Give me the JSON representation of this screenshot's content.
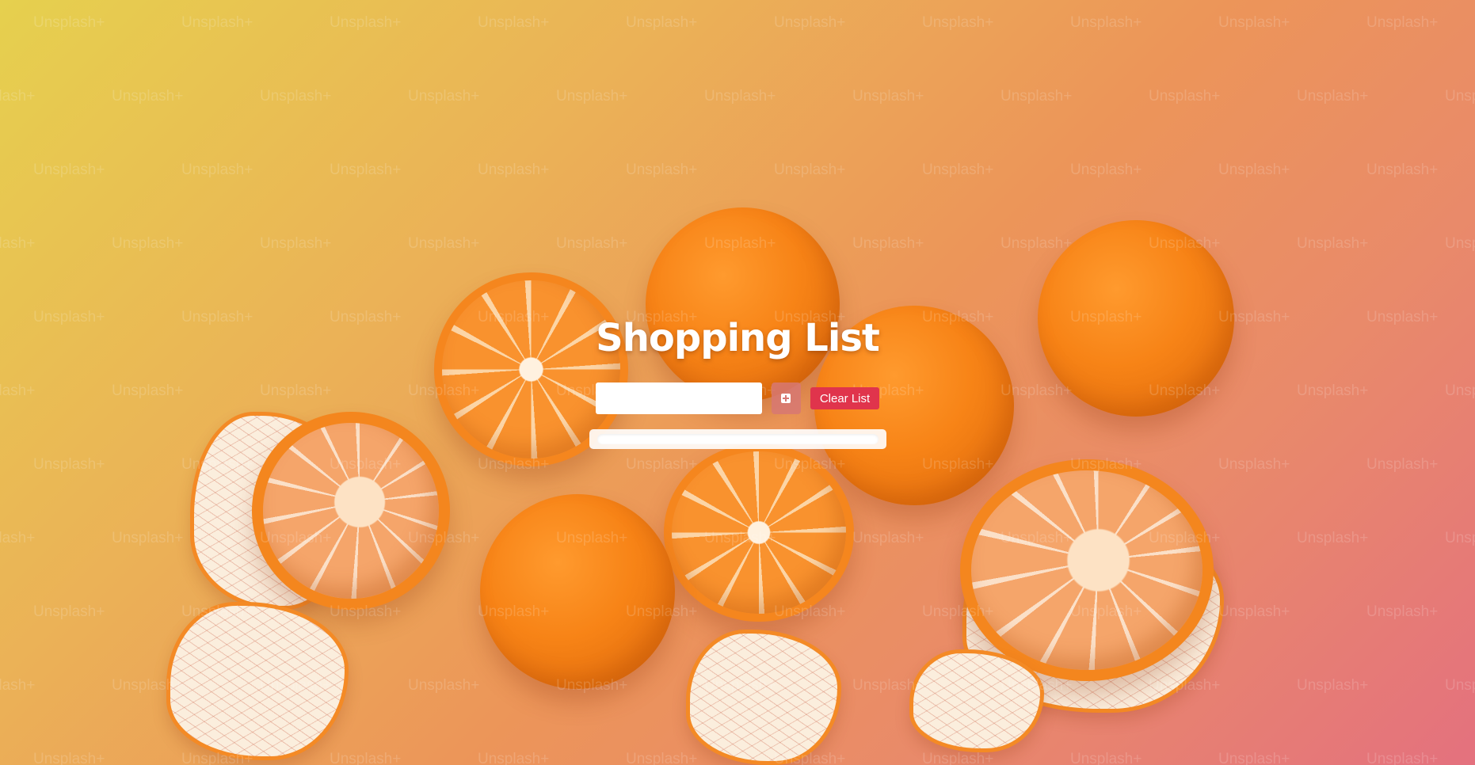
{
  "app": {
    "title": "Shopping List",
    "input": {
      "value": "",
      "placeholder": ""
    },
    "add_button_icon": "plus-square-icon",
    "clear_button_label": "Clear List",
    "items": []
  },
  "background": {
    "watermark_text": "Unsplash+",
    "subject": "mandarin oranges photo",
    "gradient_colors": [
      "#e6d04e",
      "#ebb257",
      "#ec9559",
      "#e98a6a",
      "#e4717e"
    ]
  },
  "colors": {
    "accent_clear": "#e0344c",
    "add_button": "#d77873",
    "title_text": "#ffffff"
  }
}
